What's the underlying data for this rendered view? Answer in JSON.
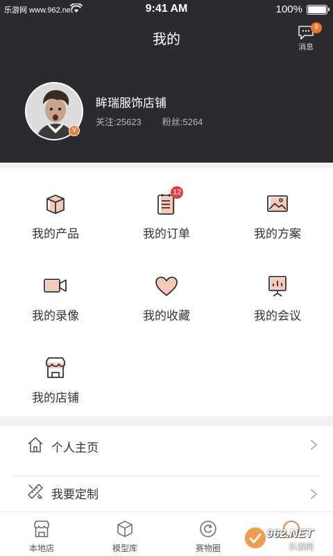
{
  "status_bar": {
    "carrier": "乐游网 www.962.net",
    "time": "9:41 AM",
    "battery": "100%"
  },
  "nav": {
    "title": "我的",
    "message_label": "消息",
    "message_count": "9"
  },
  "profile": {
    "shop_name": "眸瑞服饰店铺",
    "verified_badge": "V",
    "follow_label": "关注:",
    "follow_count": "25623",
    "fans_label": "粉丝:",
    "fans_count": "5264"
  },
  "grid": [
    {
      "label": "我的产品",
      "icon": "box-icon"
    },
    {
      "label": "我的订单",
      "icon": "clipboard-icon",
      "badge": "12"
    },
    {
      "label": "我的方案",
      "icon": "image-icon"
    },
    {
      "label": "我的录像",
      "icon": "video-camera-icon"
    },
    {
      "label": "我的收藏",
      "icon": "heart-icon"
    },
    {
      "label": "我的会议",
      "icon": "presentation-board-icon"
    },
    {
      "label": "我的店铺",
      "icon": "store-icon"
    }
  ],
  "list": [
    {
      "label": "个人主页",
      "icon": "home-icon"
    },
    {
      "label": "我要定制",
      "icon": "ruler-pencil-icon"
    }
  ],
  "tabs": [
    {
      "label": "本地店",
      "icon": "store-icon"
    },
    {
      "label": "模型库",
      "icon": "cube-icon"
    },
    {
      "label": "赛物圈",
      "icon": "refresh-circle-icon"
    },
    {
      "label": "",
      "icon": "profile-tab-icon"
    }
  ],
  "watermark": {
    "text": "962.NET",
    "sub": "乐游网"
  },
  "colors": {
    "header_bg": "#2a2a30",
    "accent": "#f0752c",
    "icon_fill": "#f7c9b8",
    "badge_red": "#e83b3b"
  }
}
